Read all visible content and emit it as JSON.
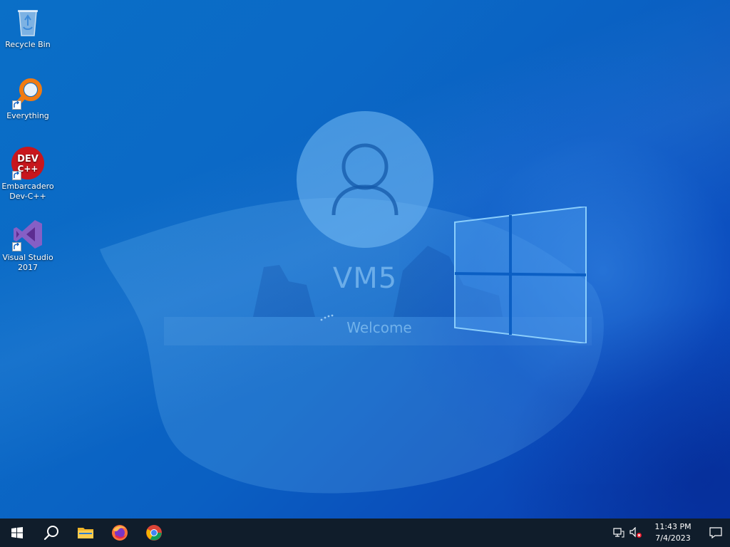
{
  "desktop": {
    "icons": [
      {
        "label": "Recycle Bin",
        "icon": "recycle-bin-icon"
      },
      {
        "label": "Everything",
        "icon": "everything-search-icon"
      },
      {
        "label": "Embarcadero Dev-C++",
        "icon": "dev-cpp-icon",
        "badge_line1": "DEV",
        "badge_line2": "C++"
      },
      {
        "label": "Visual Studio 2017",
        "icon": "visual-studio-icon"
      }
    ]
  },
  "welcome_screen": {
    "user_name": "VM5",
    "status_text": "Welcome"
  },
  "taskbar": {
    "buttons": [
      {
        "name": "start",
        "icon": "windows-start-icon"
      },
      {
        "name": "search",
        "icon": "search-icon"
      },
      {
        "name": "file-explorer",
        "icon": "folder-icon"
      },
      {
        "name": "firefox",
        "icon": "firefox-icon"
      },
      {
        "name": "chrome",
        "icon": "chrome-icon"
      }
    ],
    "tray": {
      "network_icon": "network-icon",
      "volume_icon": "volume-muted-icon",
      "time": "11:43 PM",
      "date": "7/4/2023",
      "notification_icon": "notification-icon"
    }
  },
  "colors": {
    "wallpaper_blue": "#0a6fc7",
    "taskbar_bg": "#101d2b",
    "accent": "#0078d7"
  }
}
